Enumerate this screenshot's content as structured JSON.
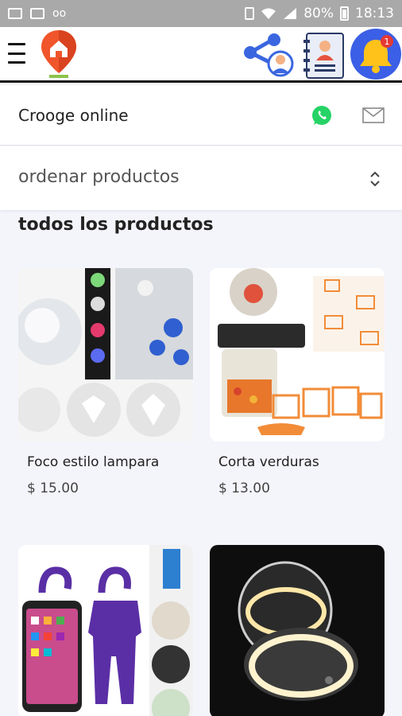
{
  "status_bar": {
    "battery": "80%",
    "time": "18:13"
  },
  "app_bar": {
    "menu_icon": "hamburger-icon",
    "logo_icon": "map-pin-home-logo",
    "share_icon": "share-user-icon",
    "contacts_icon": "contact-book-icon",
    "notifications_icon": "bell-icon",
    "notification_count": "1"
  },
  "shop": {
    "name": "Crooge online",
    "whatsapp_icon": "whatsapp-icon",
    "mail_icon": "mail-icon"
  },
  "sort": {
    "label": "ordenar productos",
    "icon": "unfold-icon"
  },
  "section_title": "todos los productos",
  "products": [
    {
      "name": "Foco estilo lampara",
      "price": "$ 15.00"
    },
    {
      "name": "Corta verduras",
      "price": "$ 13.00"
    },
    {
      "name": "",
      "price": ""
    },
    {
      "name": "",
      "price": ""
    }
  ],
  "colors": {
    "status_bar": "#a9a9a9",
    "bell_bg": "#3b5fe6",
    "whatsapp": "#25d366",
    "page_bg": "#f4f4fb"
  }
}
